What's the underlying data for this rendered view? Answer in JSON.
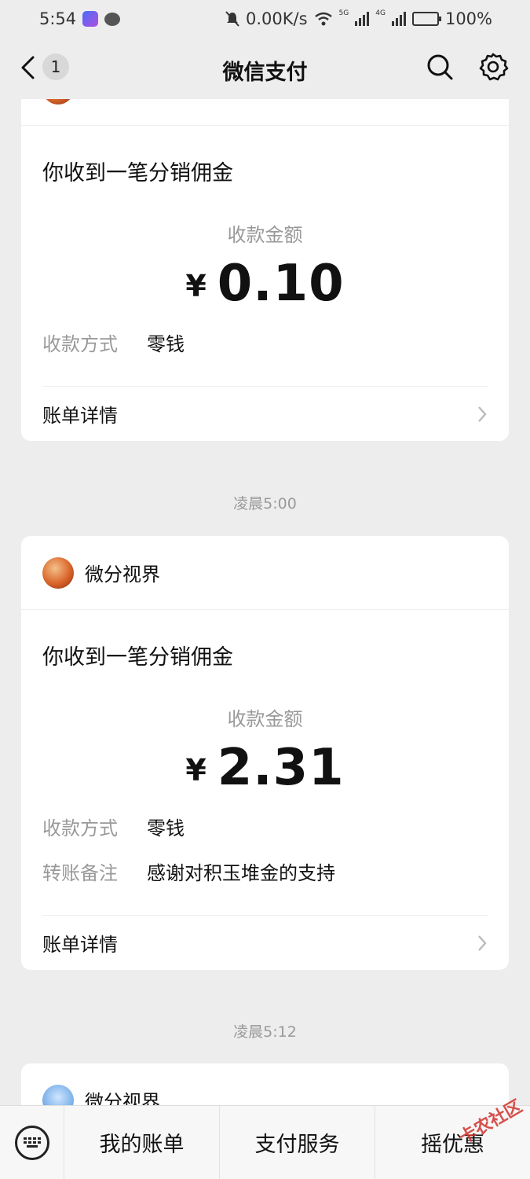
{
  "status_bar": {
    "time": "5:54",
    "net_speed": "0.00K/s",
    "net_5g": "5G",
    "net_4g": "4G",
    "battery": "100%",
    "battery_level": 1.0
  },
  "nav": {
    "back_badge": "1",
    "title": "微信支付"
  },
  "cards": [
    {
      "sender": "",
      "notice_title": "你收到一笔分销佣金",
      "amount_label": "收款金额",
      "currency": "¥",
      "amount": "0.10",
      "method_key": "收款方式",
      "method_value": "零钱",
      "detail_label": "账单详情"
    },
    {
      "sender": "微分视界",
      "notice_title": "你收到一笔分销佣金",
      "amount_label": "收款金额",
      "currency": "¥",
      "amount": "2.31",
      "method_key": "收款方式",
      "method_value": "零钱",
      "remark_key": "转账备注",
      "remark_value": "感谢对积玉堆金的支持",
      "detail_label": "账单详情"
    },
    {
      "sender": "微分视界"
    }
  ],
  "timestamps": [
    "凌晨5:00",
    "凌晨5:12"
  ],
  "bottom_menu": {
    "items": [
      "我的账单",
      "支付服务",
      "摇优惠"
    ]
  },
  "watermark": "卡农社区",
  "colors": {
    "background": "#ededed",
    "card": "#ffffff",
    "muted_text": "#999999"
  }
}
